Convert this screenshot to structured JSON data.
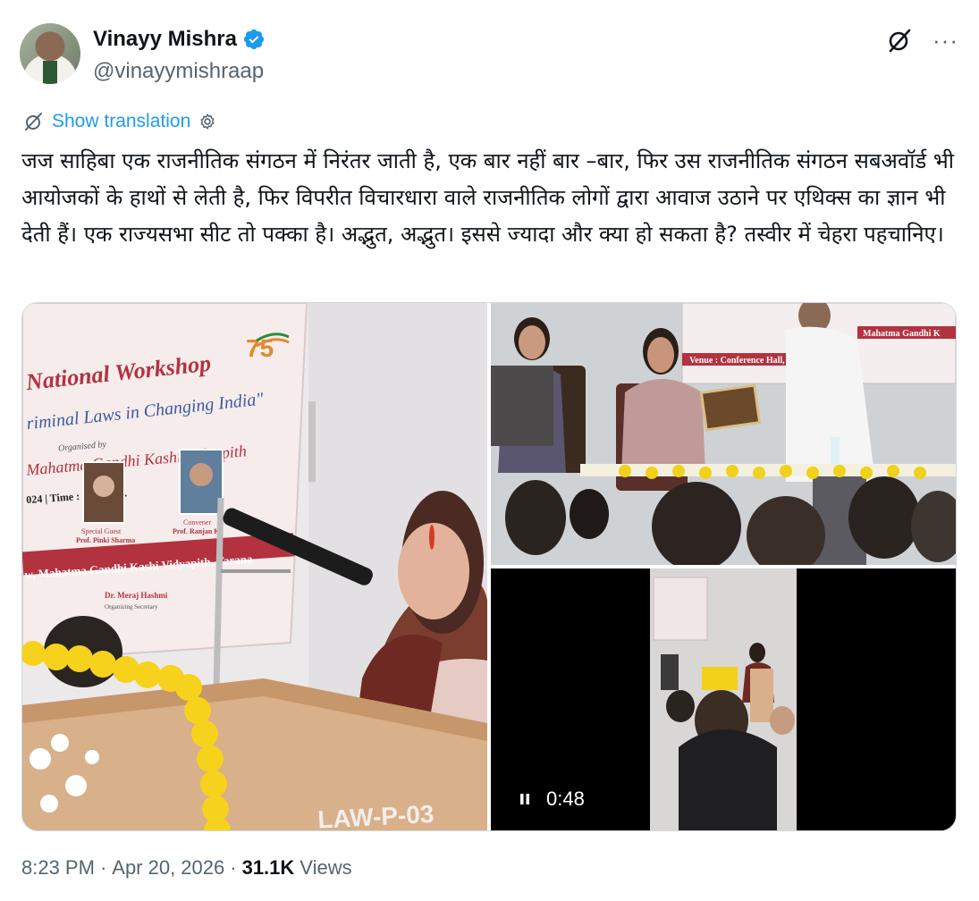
{
  "author": {
    "name": "Vinayy Mishra",
    "handle": "@vinayymishraap"
  },
  "actions": {
    "grok_icon": "grok-icon",
    "more_label": "···"
  },
  "translation": {
    "label": "Show translation"
  },
  "tweet": {
    "text": "जज साहिबा एक राजनीतिक संगठन में निरंतर जाती है, एक बार नहीं बार –बार, फिर उस राजनीतिक संगठन सबअवॉर्ड भी आयोजकों के हाथों से लेती है, फिर विपरीत विचारधारा वाले राजनीतिक लोगों द्वारा आवाज उठाने पर एथिक्स का ज्ञान भी देती हैं। एक राज्यसभा सीट तो पक्का है। अद्भुत, अद्भुत। इससे ज्यादा और क्या हो सकता है? तस्वीर में चेहरा पहचानिए।"
  },
  "media": {
    "photo1": {
      "banner_title": "National Workshop",
      "banner_subtitle": "riminal Laws in Changing India\"",
      "organized_by": "Organised by",
      "university": "Mahatma Gandhi Kashi Vidyapith",
      "time": "024 | Time : 10:30 am.",
      "special_guest_role": "Special Guest",
      "special_guest_name": "Prof. Pinki Sharma",
      "convener_role": "Convener",
      "convener_name": "Prof. Ranjan K",
      "venue": "w, Mahatma Gandhi Kashi Vidyapith, Varana",
      "secretary_name": "Dr. Meraj Hashmi",
      "secretary_role": "Organizing Secretary",
      "podium_text": "LAW-P-03"
    },
    "photo2": {
      "venue": "Venue : Conference Hall, Fa",
      "university": "Mahatma Gandhi K"
    },
    "video": {
      "duration": "0:48"
    }
  },
  "meta": {
    "time": "8:23 PM",
    "date": "Apr 20, 2026",
    "separator": "·",
    "views_count": "31.1K",
    "views_label": "Views"
  },
  "colors": {
    "accent": "#1d9bf0",
    "secondary_text": "#536471"
  }
}
